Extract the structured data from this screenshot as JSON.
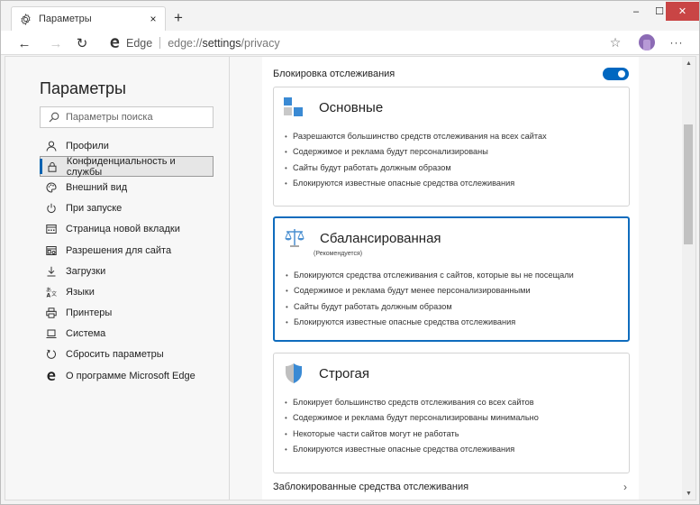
{
  "tab": {
    "title": "Параметры",
    "close_symbol": "×",
    "new_tab_symbol": "+"
  },
  "window_controls": {
    "minimize": "–",
    "maximize": "☐",
    "close": "✕"
  },
  "toolbar": {
    "back": "←",
    "forward": "→",
    "refresh": "↻",
    "site_label": "Edge",
    "url_prefix": "edge://",
    "url_bold": "settings",
    "url_suffix": "/privacy",
    "favorite_symbol": "☆",
    "more_symbol": "···"
  },
  "sidebar": {
    "title": "Параметры",
    "search_placeholder": "Параметры поиска",
    "items": [
      {
        "label": "Профили",
        "icon": "person-icon",
        "glyph": "♙"
      },
      {
        "label": "Конфиденциальность и службы",
        "icon": "lock-icon",
        "glyph": "🔒",
        "active": true
      },
      {
        "label": "Внешний вид",
        "icon": "palette-icon",
        "glyph": "◔"
      },
      {
        "label": "При запуске",
        "icon": "power-icon",
        "glyph": "⏻"
      },
      {
        "label": "Страница новой вкладки",
        "icon": "new-tab-page-icon",
        "glyph": "▤"
      },
      {
        "label": "Разрешения для сайта",
        "icon": "site-permissions-icon",
        "glyph": "▦"
      },
      {
        "label": "Загрузки",
        "icon": "download-icon",
        "glyph": "⤓"
      },
      {
        "label": "Языки",
        "icon": "languages-icon",
        "glyph": "A"
      },
      {
        "label": "Принтеры",
        "icon": "printer-icon",
        "glyph": "⎙"
      },
      {
        "label": "Система",
        "icon": "laptop-icon",
        "glyph": "▭"
      },
      {
        "label": "Сбросить параметры",
        "icon": "reset-icon",
        "glyph": "↺"
      },
      {
        "label": "О программе Microsoft Edge",
        "icon": "edge-logo-icon",
        "glyph": "e"
      }
    ]
  },
  "main": {
    "section_title": "Блокировка отслеживания",
    "tracking_prevention_enabled": true,
    "cards": [
      {
        "name": "Основные",
        "subtitle": "",
        "selected": false,
        "bullets": [
          "Разрешаются большинство средств отслеживания на всех сайтах",
          "Содержимое и реклама будут персонализированы",
          "Сайты будут работать должным образом",
          "Блокируются известные опасные средства отслеживания"
        ]
      },
      {
        "name": "Сбалансированная",
        "subtitle": "(Рекомендуется)",
        "selected": true,
        "bullets": [
          "Блокируются средства отслеживания с сайтов, которые вы не посещали",
          "Содержимое и реклама будут менее персонализированными",
          "Сайты будут работать должным образом",
          "Блокируются известные опасные средства отслеживания"
        ]
      },
      {
        "name": "Строгая",
        "subtitle": "",
        "selected": false,
        "bullets": [
          "Блокирует большинство средств отслеживания со всех сайтов",
          "Содержимое и реклама будут персонализированы минимально",
          "Некоторые части сайтов могут не работать",
          "Блокируются известные опасные средства отслеживания"
        ]
      }
    ],
    "blocked_trackers_link": "Заблокированные средства отслеживания",
    "chevron": "›"
  },
  "colors": {
    "accent": "#0067c0",
    "selected_border": "#0f6cbd",
    "close_button": "#c94545"
  }
}
